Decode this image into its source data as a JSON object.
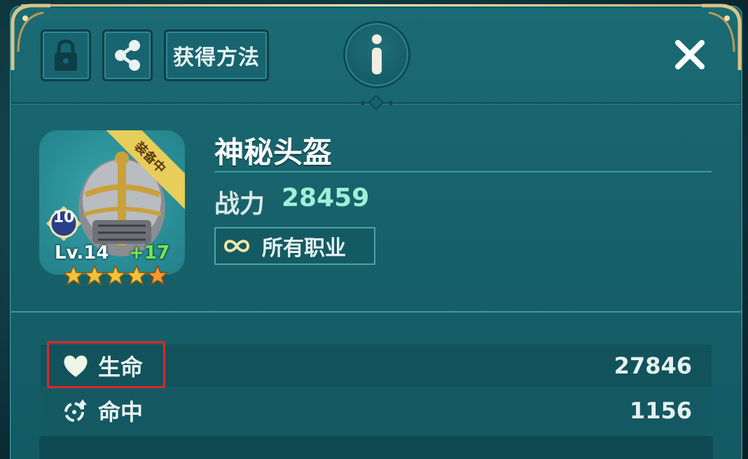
{
  "toolbar": {
    "obtain_label": "获得方法"
  },
  "item": {
    "name": "神秘头盔",
    "power_label": "战力",
    "power_value": "28459",
    "class_label": "所有职业",
    "equipped_ribbon": "装备中",
    "refine_level": "10",
    "level_text": "Lv.14",
    "plus_text": "+17",
    "star_count": 5
  },
  "stats": [
    {
      "icon": "heart-icon",
      "label": "生命",
      "value": "27846"
    },
    {
      "icon": "crosshair-arrow-icon",
      "label": "命中",
      "value": "1156"
    }
  ],
  "colors": {
    "panel": "#17626b",
    "power_value": "#9ef0d8",
    "plus_text": "#7ae84b",
    "ribbon": "#e8cd5a",
    "highlight": "#e0262a"
  }
}
